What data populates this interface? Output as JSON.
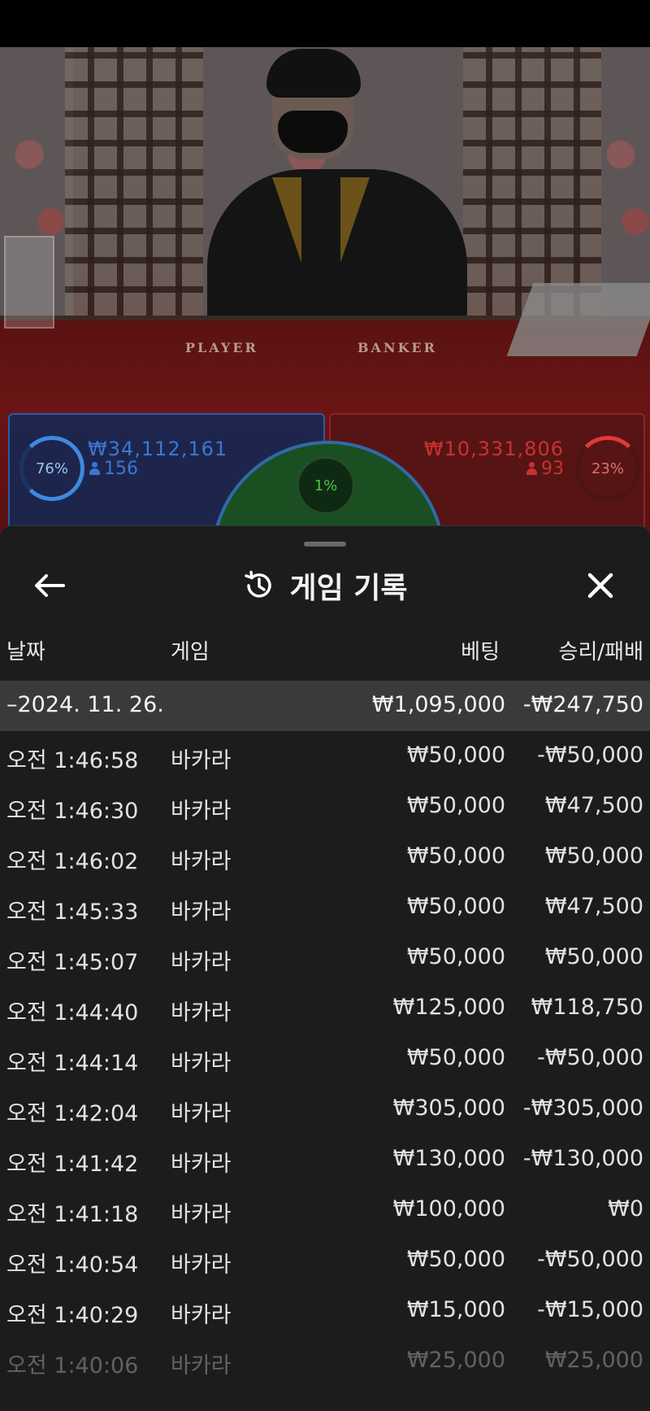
{
  "video": {
    "table_labels": {
      "player": "PLAYER",
      "banker": "BANKER"
    },
    "player_side": {
      "percent": "76%",
      "amount": "₩34,112,161",
      "bettors": "156"
    },
    "banker_side": {
      "percent": "23%",
      "amount": "₩10,331,806",
      "bettors": "93"
    },
    "tie": {
      "percent": "1%"
    }
  },
  "sheet": {
    "title": "게임 기록",
    "icons": {
      "back": "arrow-left-icon",
      "history": "history-icon",
      "close": "close-icon"
    },
    "columns": {
      "date": "날짜",
      "game": "게임",
      "bet": "베팅",
      "win_loss": "승리/패배"
    },
    "group": {
      "date": "–2024. 11. 26.",
      "bet": "₩1,095,000",
      "win_loss": "-₩247,750"
    },
    "rows": [
      {
        "time": "오전 1:46:58",
        "game": "바카라",
        "bet": "₩50,000",
        "win_loss": "-₩50,000"
      },
      {
        "time": "오전 1:46:30",
        "game": "바카라",
        "bet": "₩50,000",
        "win_loss": "₩47,500"
      },
      {
        "time": "오전 1:46:02",
        "game": "바카라",
        "bet": "₩50,000",
        "win_loss": "₩50,000"
      },
      {
        "time": "오전 1:45:33",
        "game": "바카라",
        "bet": "₩50,000",
        "win_loss": "₩47,500"
      },
      {
        "time": "오전 1:45:07",
        "game": "바카라",
        "bet": "₩50,000",
        "win_loss": "₩50,000"
      },
      {
        "time": "오전 1:44:40",
        "game": "바카라",
        "bet": "₩125,000",
        "win_loss": "₩118,750"
      },
      {
        "time": "오전 1:44:14",
        "game": "바카라",
        "bet": "₩50,000",
        "win_loss": "-₩50,000"
      },
      {
        "time": "오전 1:42:04",
        "game": "바카라",
        "bet": "₩305,000",
        "win_loss": "-₩305,000"
      },
      {
        "time": "오전 1:41:42",
        "game": "바카라",
        "bet": "₩130,000",
        "win_loss": "-₩130,000"
      },
      {
        "time": "오전 1:41:18",
        "game": "바카라",
        "bet": "₩100,000",
        "win_loss": "₩0"
      },
      {
        "time": "오전 1:40:54",
        "game": "바카라",
        "bet": "₩50,000",
        "win_loss": "-₩50,000"
      },
      {
        "time": "오전 1:40:29",
        "game": "바카라",
        "bet": "₩15,000",
        "win_loss": "-₩15,000"
      },
      {
        "time": "오전 1:40:06",
        "game": "바카라",
        "bet": "₩25,000",
        "win_loss": "₩25,000"
      }
    ]
  },
  "colors": {
    "player_blue": "#3a78d0",
    "banker_red": "#c83232",
    "tie_green": "#4cc04c",
    "sheet_bg": "#1c1c1c"
  }
}
